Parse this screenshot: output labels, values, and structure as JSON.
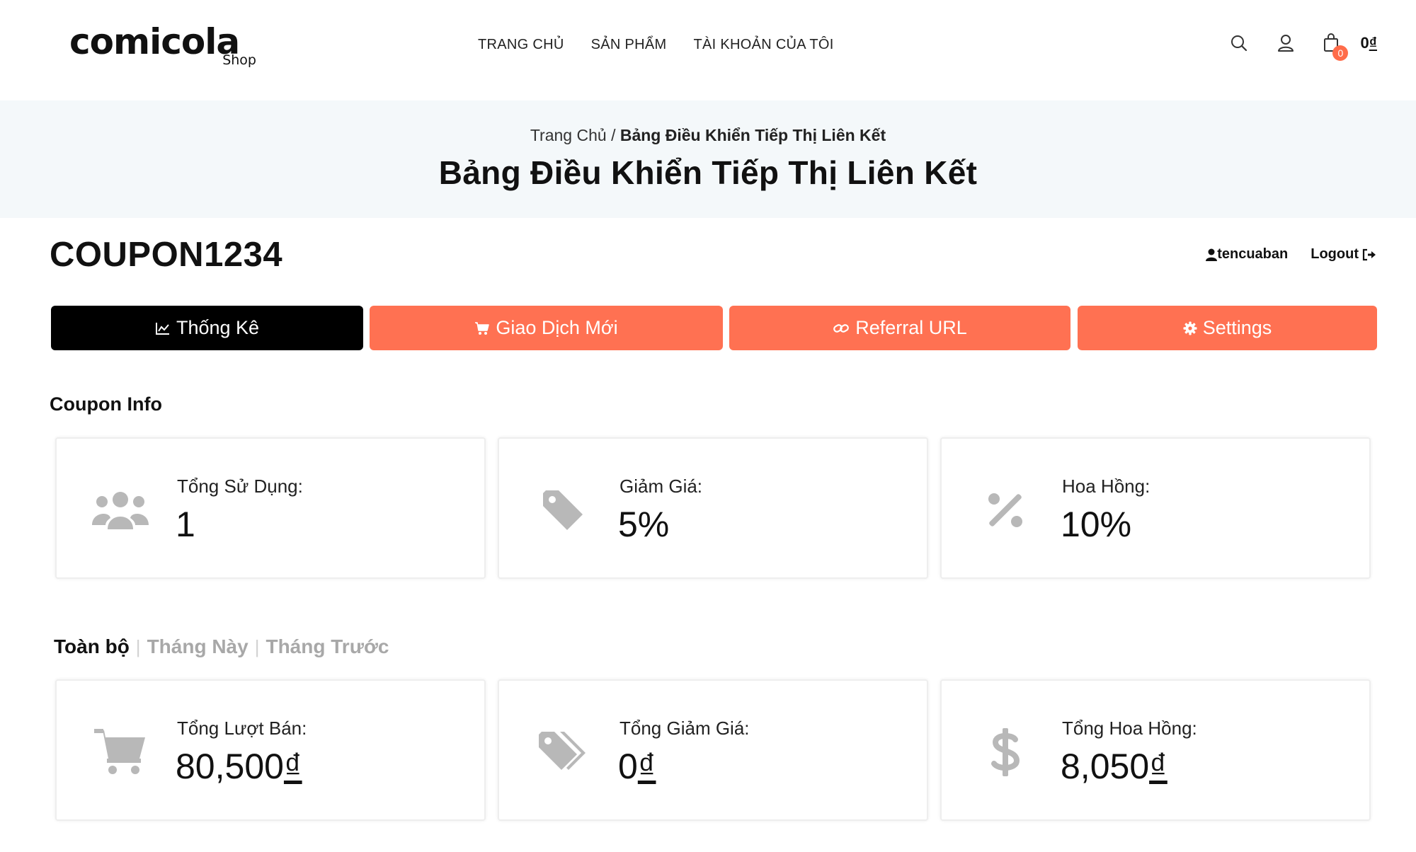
{
  "brand": {
    "name": "comicola",
    "sub": "Shop"
  },
  "nav": [
    {
      "label": "TRANG CHỦ"
    },
    {
      "label": "SẢN PHẨM"
    },
    {
      "label": "TÀI KHOẢN CỦA TÔI"
    }
  ],
  "cart": {
    "count": "0",
    "total": "0",
    "currency": "₫"
  },
  "breadcrumb": {
    "home": "Trang Chủ",
    "separator": "/",
    "current": "Bảng Điều Khiển Tiếp Thị Liên Kết"
  },
  "page_title": "Bảng Điều Khiển Tiếp Thị Liên Kết",
  "coupon_code": "COUPON1234",
  "user": {
    "name": "tencuaban",
    "logout_label": "Logout"
  },
  "tabs": [
    {
      "label": "Thống Kê",
      "icon": "chart-line-icon",
      "active": true
    },
    {
      "label": "Giao Dịch Mới",
      "icon": "shopping-cart-icon",
      "active": false
    },
    {
      "label": "Referral URL",
      "icon": "link-icon",
      "active": false
    },
    {
      "label": "Settings",
      "icon": "gear-icon",
      "active": false
    }
  ],
  "coupon_info": {
    "title": "Coupon Info",
    "cards": [
      {
        "label": "Tổng Sử Dụng:",
        "value": "1",
        "icon": "users-icon"
      },
      {
        "label": "Giảm Giá:",
        "value": "5%",
        "icon": "tag-icon"
      },
      {
        "label": "Hoa Hồng:",
        "value": "10%",
        "icon": "percent-icon"
      }
    ]
  },
  "period_tabs": [
    {
      "label": "Toàn bộ",
      "active": true
    },
    {
      "label": "Tháng Này",
      "active": false
    },
    {
      "label": "Tháng Trước",
      "active": false
    }
  ],
  "stats": {
    "cards": [
      {
        "label": "Tổng Lượt Bán:",
        "value": "80,500",
        "currency": "₫",
        "icon": "cart-icon"
      },
      {
        "label": "Tổng Giảm Giá:",
        "value": "0",
        "currency": "₫",
        "icon": "tags-icon"
      },
      {
        "label": "Tổng Hoa Hồng:",
        "value": "8,050",
        "currency": "₫",
        "icon": "dollar-icon"
      }
    ]
  },
  "colors": {
    "accent": "#ff7152",
    "active_tab": "#000000",
    "band": "#f4f8fa",
    "icon_gray": "#b8b8b8"
  }
}
